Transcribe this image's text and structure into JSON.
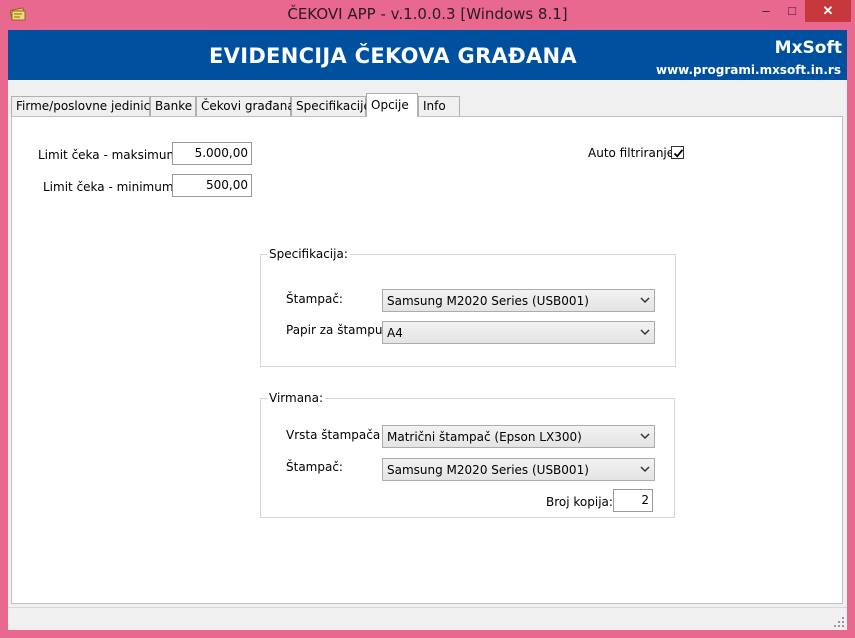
{
  "window": {
    "title": "ČEKOVI APP - v.1.0.0.3  [Windows 8.1]",
    "minimize": "–",
    "maximize": "□",
    "close": "✕"
  },
  "header": {
    "title": "EVIDENCIJA ČEKOVA GRAĐANA",
    "brand": "MxSoft",
    "url": "www.programi.mxsoft.in.rs"
  },
  "tabs": [
    {
      "label": "Firme/poslovne jedinice"
    },
    {
      "label": "Banke"
    },
    {
      "label": "Čekovi građana"
    },
    {
      "label": "Specifikacije"
    },
    {
      "label": "Opcije"
    },
    {
      "label": "Info"
    }
  ],
  "options": {
    "limit_max_label": "Limit čeka - maksimum:",
    "limit_max_value": "5.000,00",
    "limit_min_label": "Limit  čeka - minimum:",
    "limit_min_value": "500,00",
    "auto_filter_label": "Auto filtriranje",
    "auto_filter_checked": true
  },
  "specifikacija": {
    "title": "Specifikacija:",
    "printer_label": "Štampač:",
    "printer_value": "Samsung M2020 Series (USB001)",
    "paper_label": "Papir za štampu:",
    "paper_value": "A4"
  },
  "virmana": {
    "title": "Virmana:",
    "printer_type_label": "Vrsta štampača",
    "printer_type_value": "Matrični štampač (Epson LX300)",
    "printer_label": "Štampač:",
    "printer_value": "Samsung M2020 Series (USB001)",
    "copies_label": "Broj kopija:",
    "copies_value": "2"
  },
  "colors": {
    "frame": "#e8688f",
    "banner": "#0050a0",
    "close_button": "#c7383d"
  }
}
